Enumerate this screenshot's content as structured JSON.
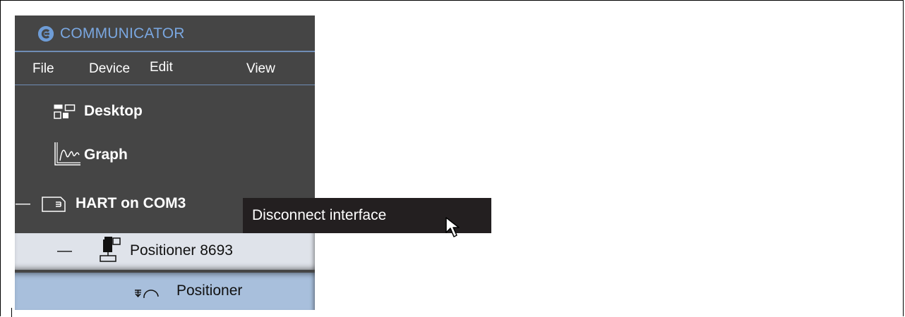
{
  "app": {
    "title": "COMMUNICATOR"
  },
  "menu": {
    "file": "File",
    "device": "Device",
    "edit": "Edit",
    "view": "View"
  },
  "tree": {
    "desktop": "Desktop",
    "graph": "Graph",
    "hart": "HART on COM3",
    "hart_toggle": "—",
    "positioner_device": "Positioner 8693",
    "positioner_device_toggle": "—",
    "positioner": "Positioner"
  },
  "tooltip": {
    "text": "Disconnect interface"
  },
  "colors": {
    "panel_bg": "#454545",
    "accent": "#7aa7e0",
    "selected_row": "#a8bfdc",
    "hover_row": "#dfe3ea",
    "tooltip_bg": "#231f20"
  },
  "icons": [
    "logo-icon",
    "desktop-icon",
    "graph-icon",
    "folder-interface-icon",
    "device-icon",
    "positioner-function-icon",
    "mouse-cursor-icon"
  ]
}
